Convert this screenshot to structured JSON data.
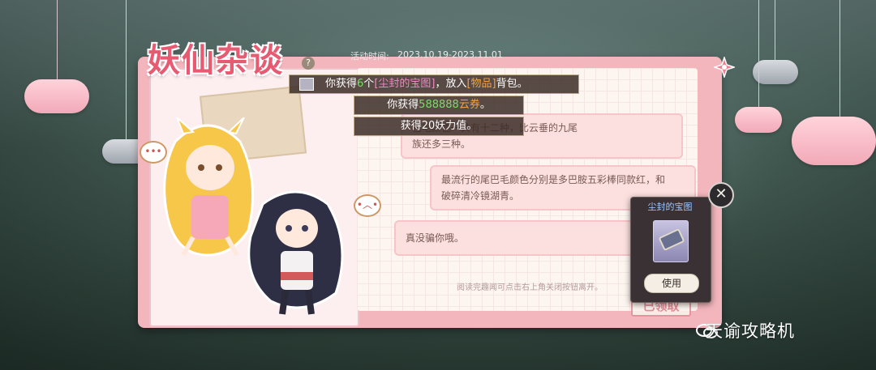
{
  "event": {
    "title": "妖仙杂谈",
    "help_label": "?",
    "time_label": "活动时间:",
    "time_range": "2023.10.19-2023.11.01"
  },
  "toasts": {
    "first": {
      "prefix": "你获得",
      "count": "6",
      "mid": "个",
      "item": "[尘封的宝图]",
      "comma": "，放入",
      "bag": "[物品]",
      "suffix": "背包。"
    },
    "second": {
      "prefix": "你获得",
      "amount": "588888",
      "currency": "云券",
      "suffix": "。"
    },
    "third": {
      "text": "获得20妖力值。"
    }
  },
  "chat": {
    "bubble1_line1": "巴毛颜色一共有十二种，比云垂的九尾",
    "bubble1_line2": "族还多三种。",
    "bubble2_line1": "最流行的尾巴毛颜色分别是多巴胺五彩棒同款红，和",
    "bubble2_line2": "破碎清冷镜湖青。",
    "bubble3": "真没骗你哦。",
    "hint": "阅读完趣闻可点击右上角关闭按钮离开。",
    "claimed": "已领取"
  },
  "popup": {
    "title": "尘封的宝图",
    "use_label": "使用",
    "close_glyph": "✕"
  },
  "watermark": {
    "text": "天谕攻略机"
  },
  "colors": {
    "accent_pink": "#e65a72",
    "toast_bg": "#3c2d28",
    "green": "#7cdc6a",
    "orange": "#f0a544"
  }
}
